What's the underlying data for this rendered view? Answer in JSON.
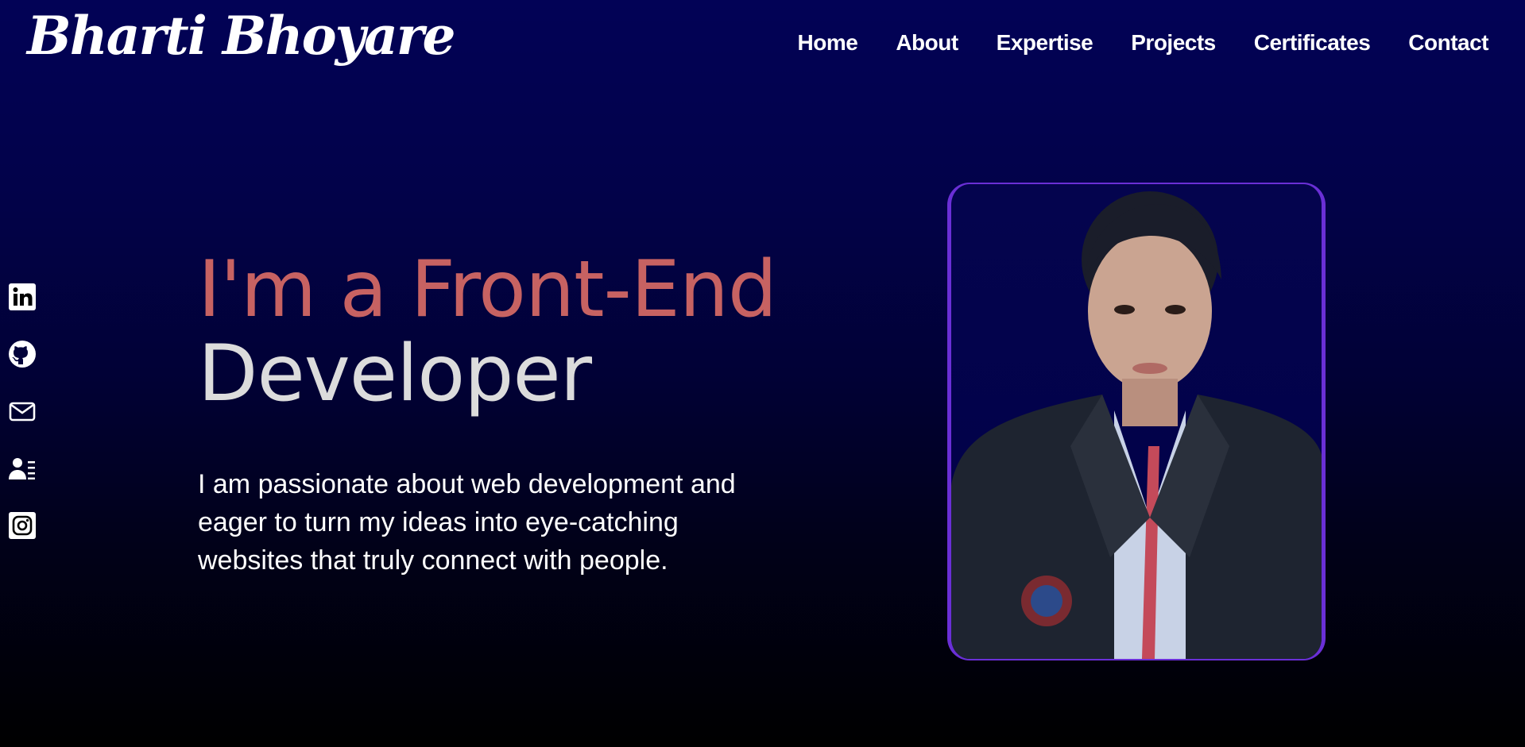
{
  "header": {
    "logo": "Bharti Bhoyare",
    "nav": [
      "Home",
      "About",
      "Expertise",
      "Projects",
      "Certificates",
      "Contact"
    ]
  },
  "social": [
    {
      "icon": "linkedin-icon"
    },
    {
      "icon": "github-icon"
    },
    {
      "icon": "mail-icon"
    },
    {
      "icon": "resume-icon"
    },
    {
      "icon": "instagram-icon"
    }
  ],
  "hero": {
    "title_line1": "I'm a Front-End",
    "title_line2": "Developer",
    "description": "I am passionate about web development and eager to turn my ideas into eye-catching websites that truly connect with people."
  },
  "colors": {
    "accent": "#c76262",
    "frame": "#6a2fd6",
    "background_top": "#020256",
    "background_bottom": "#000000"
  }
}
